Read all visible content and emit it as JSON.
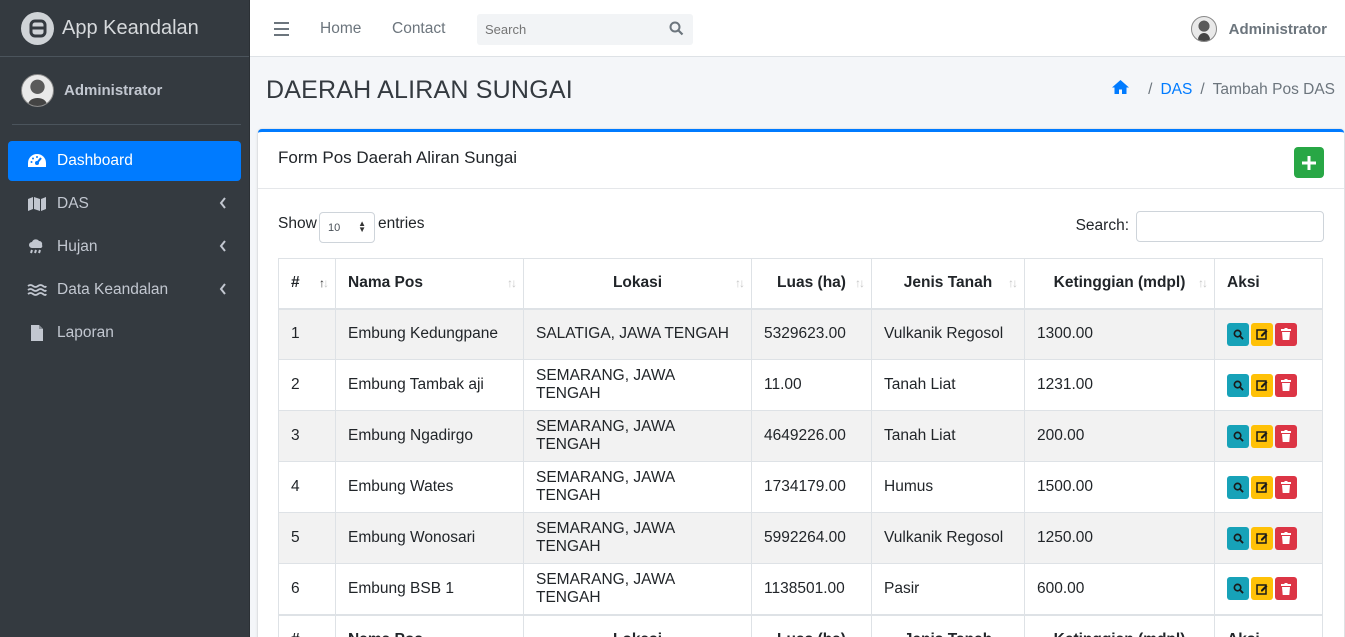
{
  "brand": {
    "name": "App Keandalan"
  },
  "sidebar": {
    "user": "Administrator",
    "items": [
      {
        "label": "Dashboard",
        "icon": "tachometer-icon",
        "active": true,
        "has_arrow": false
      },
      {
        "label": "DAS",
        "icon": "map-icon",
        "active": false,
        "has_arrow": true
      },
      {
        "label": "Hujan",
        "icon": "cloud-rain-icon",
        "active": false,
        "has_arrow": true
      },
      {
        "label": "Data Keandalan",
        "icon": "water-icon",
        "active": false,
        "has_arrow": true
      },
      {
        "label": "Laporan",
        "icon": "file-icon",
        "active": false,
        "has_arrow": false
      }
    ]
  },
  "topbar": {
    "links": [
      "Home",
      "Contact"
    ],
    "search_placeholder": "Search",
    "user": "Administrator"
  },
  "page": {
    "title": "DAERAH ALIRAN SUNGAI",
    "breadcrumb": {
      "link": "DAS",
      "current": "Tambah Pos DAS"
    }
  },
  "card": {
    "title": "Form Pos Daerah Aliran Sungai",
    "show_label": "Show",
    "page_length": "10",
    "entries_label": "entries",
    "search_label": "Search:"
  },
  "table": {
    "columns": [
      "#",
      "Nama Pos",
      "Lokasi",
      "Luas (ha)",
      "Jenis Tanah",
      "Ketinggian (mdpl)",
      "Aksi"
    ],
    "rows": [
      [
        "1",
        "Embung Kedungpane",
        "SALATIGA, JAWA TENGAH",
        "5329623.00",
        "Vulkanik Regosol",
        "1300.00"
      ],
      [
        "2",
        "Embung Tambak aji",
        "SEMARANG, JAWA TENGAH",
        "11.00",
        "Tanah Liat",
        "1231.00"
      ],
      [
        "3",
        "Embung Ngadirgo",
        "SEMARANG, JAWA TENGAH",
        "4649226.00",
        "Tanah Liat",
        "200.00"
      ],
      [
        "4",
        "Embung Wates",
        "SEMARANG, JAWA TENGAH",
        "1734179.00",
        "Humus",
        "1500.00"
      ],
      [
        "5",
        "Embung Wonosari",
        "SEMARANG, JAWA TENGAH",
        "5992264.00",
        "Vulkanik Regosol",
        "1250.00"
      ],
      [
        "6",
        "Embung BSB 1",
        "SEMARANG, JAWA TENGAH",
        "1138501.00",
        "Pasir",
        "600.00"
      ]
    ]
  },
  "colors": {
    "primary": "#007bff",
    "success": "#28a745",
    "info": "#17a2b8",
    "warning": "#ffc107",
    "danger": "#dc3545",
    "sidebar": "#343a40"
  }
}
